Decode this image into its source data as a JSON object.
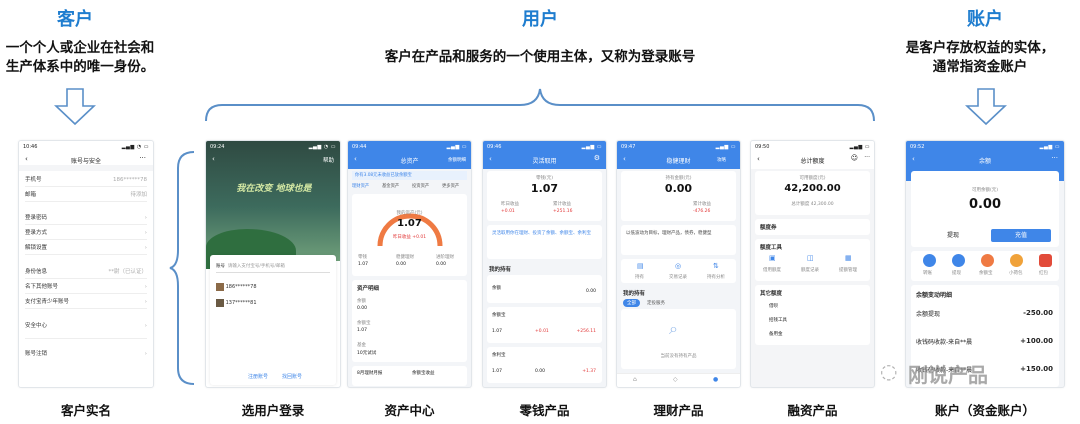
{
  "customer": {
    "heading": "客户",
    "desc_line1": "一个个人或企业在社会和",
    "desc_line2": "生产体系中的唯一身份。",
    "caption": "客户实名"
  },
  "user": {
    "heading": "用户",
    "desc": "客户在产品和服务的一个使用主体，又称为登录账号"
  },
  "account": {
    "heading": "账户",
    "desc_line1": "是客户存放权益的实体，",
    "desc_line2": "通常指资金账户",
    "caption": "账户（资金账户）"
  },
  "captions": {
    "login": "选用户登录",
    "asset": "资产中心",
    "change": "零钱产品",
    "wealth": "理财产品",
    "finance": "融资产品"
  },
  "watermark": "刚说产品",
  "screens": {
    "s1": {
      "time": "10:46",
      "title": "账号与安全",
      "rows": [
        {
          "label": "手机号",
          "value": "186******78"
        },
        {
          "label": "邮箱",
          "value": "待添加"
        },
        {
          "label": "登录密码",
          "value": ""
        },
        {
          "label": "登录方式",
          "value": ""
        },
        {
          "label": "解锁设置",
          "value": ""
        },
        {
          "label": "身份信息",
          "value": "**尉（已认证）"
        },
        {
          "label": "名下其他账号",
          "value": ""
        },
        {
          "label": "支付宝青少年账号",
          "value": ""
        },
        {
          "label": "安全中心",
          "value": ""
        },
        {
          "label": "账号注销",
          "value": ""
        }
      ]
    },
    "s2": {
      "time": "09:24",
      "help": "帮助",
      "banner": "我在改变 地球也是",
      "input": "请输入支付宝号/手机号/邮箱",
      "accounts": [
        "186******78",
        "137******81"
      ],
      "links": [
        "注册账号",
        "找回账号"
      ]
    },
    "s3": {
      "time": "09:44",
      "title": "总资产",
      "more": "余额明细",
      "notice": "你有3.08元未收益已放余额宝",
      "tabs": [
        "理财资产",
        "基金资产",
        "投资资产",
        "更多资产"
      ],
      "total_label": "我的资产(元)",
      "total": "1.07",
      "yesterday": "昨日收益 +0.01",
      "cols": [
        {
          "name": "零钱",
          "value": "1.07"
        },
        {
          "name": "稳健理财",
          "value": "0.00"
        },
        {
          "name": "进阶理财",
          "value": "0.00"
        }
      ],
      "detail_title": "资产明细",
      "items": [
        {
          "name": "余额",
          "value": "0.00"
        },
        {
          "name": "余额宝",
          "value": "1.07"
        },
        {
          "name": "基金",
          "value": "10元试试"
        }
      ],
      "footer": [
        "8月理财月报",
        "余额宝收益"
      ]
    },
    "s4": {
      "time": "09:46",
      "title": "灵活取用",
      "asset_label": "零钱(元)",
      "asset": "1.07",
      "yesterday": "+0.01",
      "total_income": "+251.16",
      "tip": "灵活取用你在理财、投资了余额、余额宝、余利宝",
      "section": "我的持有",
      "items": [
        {
          "name": "余额",
          "value": "0.00"
        },
        {
          "name": "余额宝",
          "value": "1.07",
          "income": "+0.01",
          "total": "+256.11"
        },
        {
          "name": "余利宝",
          "value": "1.07",
          "income": "0.00",
          "total": "+1.37"
        }
      ]
    },
    "s5": {
      "time": "09:47",
      "title": "稳健理财",
      "more": "攻略",
      "asset_label": "持有金额(元)",
      "asset": "0.00",
      "income_label": "累计收益",
      "income": "-476.26",
      "tip": "以低波动为目标，理财产品，债券，稳健型",
      "icons": [
        "持有",
        "交易记录",
        "持有分析"
      ],
      "section": "我的持有",
      "tabs": [
        "全部",
        "定投服务"
      ],
      "empty": "当前没有持有产品"
    },
    "s6": {
      "time": "09:50",
      "title": "总计额度",
      "limit_label": "可用额度(元)",
      "limit": "42,200.00",
      "total": "总计额度 42,300.00",
      "section1": "额度券",
      "section2": "额度工具",
      "tools": [
        "借用额度",
        "额度记录",
        "提额管理"
      ],
      "section3": "其它额度",
      "items": [
        "借呗",
        "招钱工具",
        "备用金"
      ]
    },
    "s7": {
      "time": "09:52",
      "title": "余额",
      "limit_label": "可用余额(元)",
      "balance": "0.00",
      "btn_withdraw": "提现",
      "btn_recharge": "充值",
      "icons": [
        "转账",
        "提现",
        "余额宝",
        "小荷包",
        "红包"
      ],
      "detail": "余额变动明细",
      "records": [
        {
          "name": "余额提现",
          "amount": "-250.00"
        },
        {
          "name": "收钱码收款-来自**晨",
          "amount": "+100.00"
        },
        {
          "name": "收钱码收款-来自**晨",
          "amount": "+150.00"
        }
      ]
    }
  }
}
